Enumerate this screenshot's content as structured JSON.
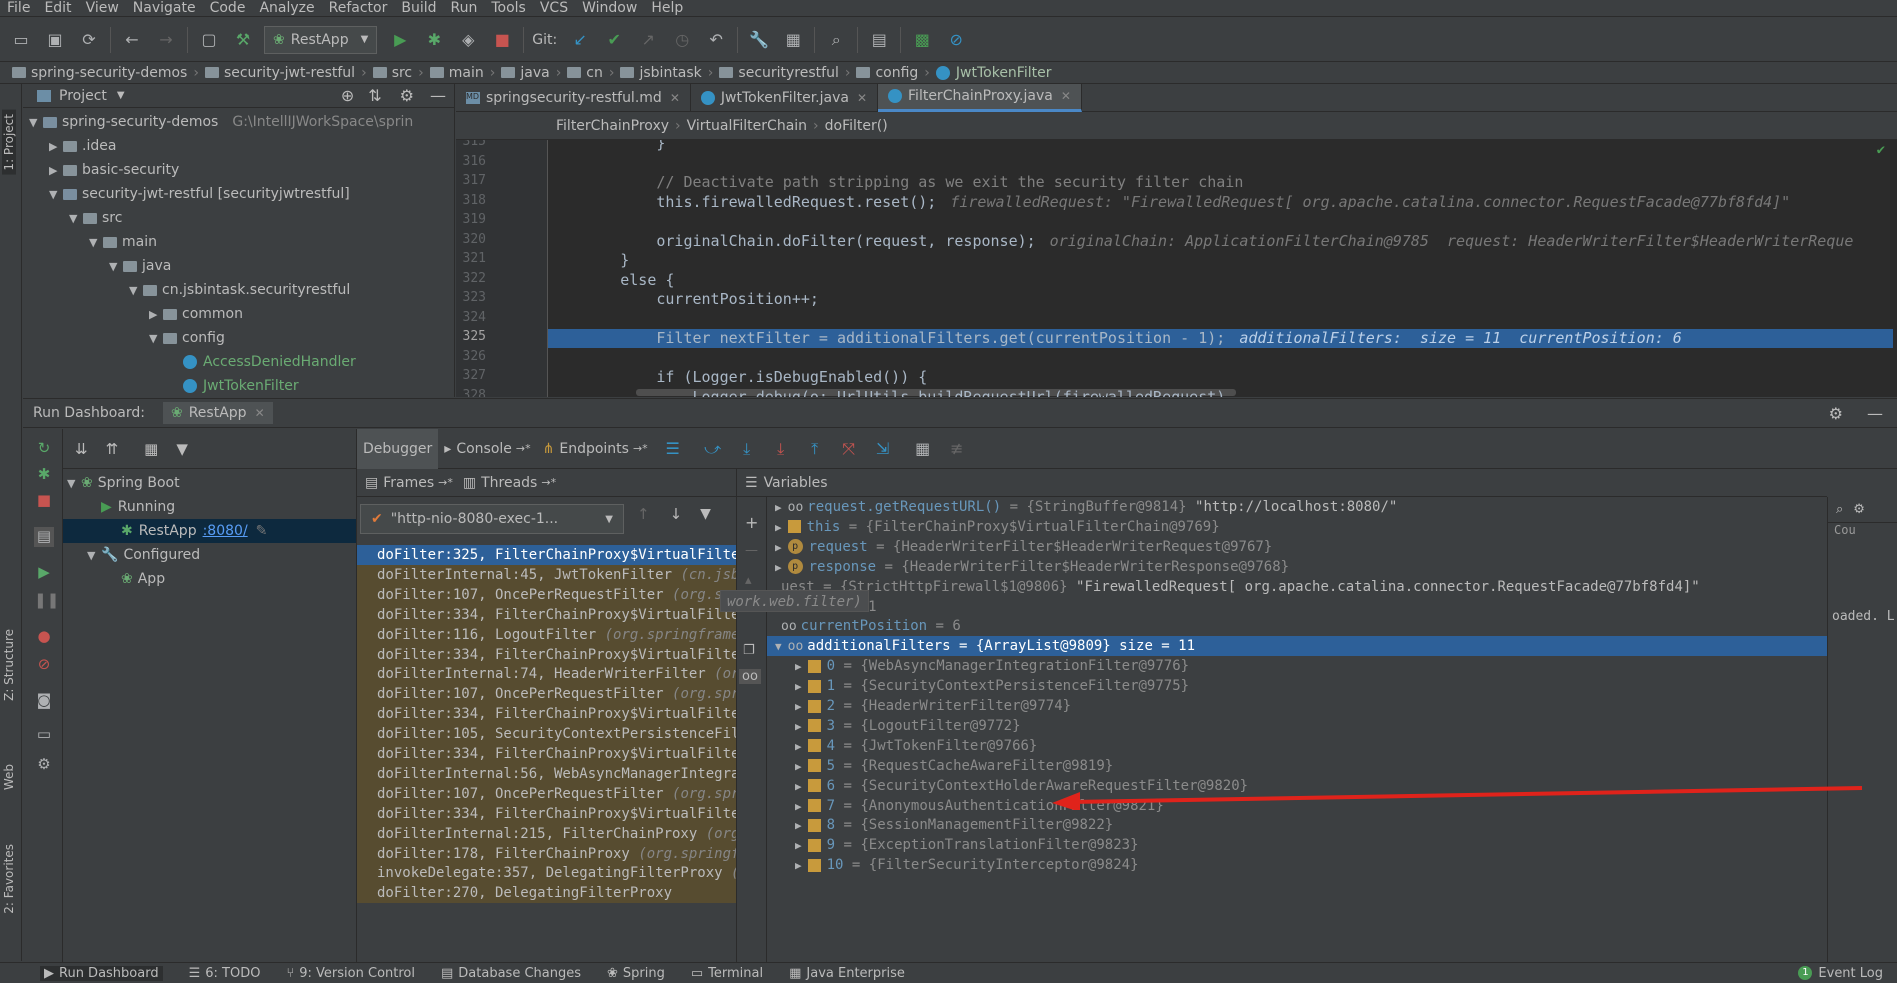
{
  "menu": [
    "File",
    "Edit",
    "View",
    "Navigate",
    "Code",
    "Analyze",
    "Refactor",
    "Build",
    "Run",
    "Tools",
    "VCS",
    "Window",
    "Help"
  ],
  "toolbar": {
    "run_config": "RestApp",
    "git_label": "Git:"
  },
  "breadcrumb": [
    "spring-security-demos",
    "security-jwt-restful",
    "src",
    "main",
    "java",
    "cn",
    "jsbintask",
    "securityrestful",
    "config",
    "JwtTokenFilter"
  ],
  "project": {
    "title": "Project",
    "tree": [
      {
        "label": "spring-security-demos",
        "extra": "G:\\IntellIJWorkSpace\\sprin",
        "depth": 0,
        "state": "open"
      },
      {
        "label": ".idea",
        "extra": "",
        "depth": 1,
        "state": "closed"
      },
      {
        "label": "basic-security",
        "extra": "",
        "depth": 1,
        "state": "closed"
      },
      {
        "label": "security-jwt-restful [securityjwtrestful]",
        "extra": "",
        "depth": 1,
        "state": "open"
      },
      {
        "label": "src",
        "extra": "",
        "depth": 2,
        "state": "open"
      },
      {
        "label": "main",
        "extra": "",
        "depth": 3,
        "state": "open"
      },
      {
        "label": "java",
        "extra": "",
        "depth": 4,
        "state": "open"
      },
      {
        "label": "cn.jsbintask.securityrestful",
        "extra": "",
        "depth": 5,
        "state": "open"
      },
      {
        "label": "common",
        "extra": "",
        "depth": 6,
        "state": "closed"
      },
      {
        "label": "config",
        "extra": "",
        "depth": 6,
        "state": "open"
      },
      {
        "label": "AccessDeniedHandler",
        "extra": "",
        "depth": 7,
        "state": "class"
      },
      {
        "label": "JwtTokenFilter",
        "extra": "",
        "depth": 7,
        "state": "class"
      }
    ]
  },
  "editor": {
    "tabs": [
      {
        "label": "springsecurity-restful.md",
        "active": false
      },
      {
        "label": "JwtTokenFilter.java",
        "active": false
      },
      {
        "label": "FilterChainProxy.java",
        "active": true
      }
    ],
    "crumbs": [
      "FilterChainProxy",
      "VirtualFilterChain",
      "doFilter()"
    ],
    "current_line": "325",
    "lines": [
      {
        "n": "315",
        "code": "            }",
        "hint": ""
      },
      {
        "n": "316",
        "code": "",
        "hint": ""
      },
      {
        "n": "317",
        "code": "            // Deactivate path stripping as we exit the security filter chain",
        "hint": "",
        "comment": true
      },
      {
        "n": "318",
        "code": "            this.firewalledRequest.reset();",
        "hint": "firewalledRequest: \"FirewalledRequest[ org.apache.catalina.connector.RequestFacade@77bf8fd4]\""
      },
      {
        "n": "319",
        "code": "",
        "hint": ""
      },
      {
        "n": "320",
        "code": "            originalChain.doFilter(request, response);",
        "hint": "originalChain: ApplicationFilterChain@9785  request: HeaderWriterFilter$HeaderWriterReque"
      },
      {
        "n": "321",
        "code": "        }",
        "hint": ""
      },
      {
        "n": "322",
        "code": "        else {",
        "hint": ""
      },
      {
        "n": "323",
        "code": "            currentPosition++;",
        "hint": ""
      },
      {
        "n": "324",
        "code": "",
        "hint": ""
      },
      {
        "n": "325",
        "code": "            Filter nextFilter = additionalFilters.get(currentPosition - 1);",
        "hint": "additionalFilters:  size = 11  currentPosition: 6"
      },
      {
        "n": "326",
        "code": "",
        "hint": ""
      },
      {
        "n": "327",
        "code": "            if (Logger.isDebugEnabled()) {",
        "hint": ""
      },
      {
        "n": "328",
        "code": "                Logger.debug(o: UrlUtils.buildRequestUrl(firewalledRequest)",
        "hint": ""
      }
    ]
  },
  "run_dashboard": {
    "title": "Run Dashboard:",
    "tab": "RestApp",
    "services": [
      {
        "label": "Spring Boot",
        "depth": 0
      },
      {
        "label": "Running",
        "depth": 1
      },
      {
        "label": "RestApp",
        "port": ":8080/",
        "depth": 2,
        "selected": true
      },
      {
        "label": "Configured",
        "depth": 1
      },
      {
        "label": "App",
        "depth": 2
      }
    ]
  },
  "debugger": {
    "tabs": [
      "Debugger",
      "Console",
      "Endpoints"
    ],
    "frames_tab": "Frames",
    "threads_tab": "Threads",
    "thread": "\"http-nio-8080-exec-1...",
    "frames": [
      {
        "m": "doFilter:325, FilterChainProxy$VirtualFilterC",
        "p": "",
        "sel": true
      },
      {
        "m": "doFilterInternal:45, JwtTokenFilter",
        "p": "(cn.jsb",
        "sel": false
      },
      {
        "m": "doFilter:107, OncePerRequestFilter",
        "p": "(org.springframework.web.filter)",
        "sel": false
      },
      {
        "m": "doFilter:334, FilterChainProxy$VirtualFilterC",
        "p": "",
        "sel": false
      },
      {
        "m": "doFilter:116, LogoutFilter",
        "p": "(org.springframew",
        "sel": false
      },
      {
        "m": "doFilter:334, FilterChainProxy$VirtualFilterC",
        "p": "",
        "sel": false
      },
      {
        "m": "doFilterInternal:74, HeaderWriterFilter",
        "p": "(org.",
        "sel": false
      },
      {
        "m": "doFilter:107, OncePerRequestFilter",
        "p": "(org.sprin",
        "sel": false
      },
      {
        "m": "doFilter:334, FilterChainProxy$VirtualFilterC",
        "p": "",
        "sel": false
      },
      {
        "m": "doFilter:105, SecurityContextPersistenceFilte",
        "p": "",
        "sel": false
      },
      {
        "m": "doFilter:334, FilterChainProxy$VirtualFilterC",
        "p": "",
        "sel": false
      },
      {
        "m": "doFilterInternal:56, WebAsyncManagerIntegrati",
        "p": "",
        "sel": false
      },
      {
        "m": "doFilter:107, OncePerRequestFilter",
        "p": "(org.sprin",
        "sel": false
      },
      {
        "m": "doFilter:334, FilterChainProxy$VirtualFilterC",
        "p": "",
        "sel": false
      },
      {
        "m": "doFilterInternal:215, FilterChainProxy",
        "p": "(org.s",
        "sel": false
      },
      {
        "m": "doFilter:178, FilterChainProxy",
        "p": "(org.springfra",
        "sel": false
      },
      {
        "m": "invokeDelegate:357, DelegatingFilterProxy",
        "p": "(or",
        "sel": false
      },
      {
        "m": "doFilter:270, DelegatingFilterProxy",
        "p": "",
        "sel": false
      }
    ],
    "variables_title": "Variables",
    "variables": [
      {
        "name": "request.getRequestURL()",
        "val": "= {StringBuffer@9814} ",
        "str": "\"http://localhost:8080/\"",
        "kind": "watch",
        "indent": 0
      },
      {
        "name": "this",
        "val": "= {FilterChainProxy$VirtualFilterChain@9769}",
        "str": "",
        "kind": "arr",
        "indent": 0
      },
      {
        "name": "request",
        "val": "= {HeaderWriterFilter$HeaderWriterRequest@9767}",
        "str": "",
        "kind": "p",
        "indent": 0
      },
      {
        "name": "response",
        "val": "= {HeaderWriterFilter$HeaderWriterResponse@9768}",
        "str": "",
        "kind": "p",
        "indent": 0
      },
      {
        "name": "",
        "val": "uest = {StrictHttpFirewall$1@9806} ",
        "str": "\"FirewalledRequest[ org.apache.catalina.connector.RequestFacade@77bf8fd4]\"",
        "kind": "none",
        "indent": 0
      },
      {
        "name": "size",
        "val": "= 11",
        "str": "",
        "kind": "watch",
        "indent": 0
      },
      {
        "name": "currentPosition",
        "val": "= 6",
        "str": "",
        "kind": "watch",
        "indent": 0
      },
      {
        "name": "additionalFilters",
        "val": "= {ArrayList@9809}  size = 11",
        "str": "",
        "kind": "watch",
        "indent": 0,
        "sel": true
      },
      {
        "name": "0",
        "val": "= {WebAsyncManagerIntegrationFilter@9776}",
        "str": "",
        "kind": "arr",
        "indent": 1
      },
      {
        "name": "1",
        "val": "= {SecurityContextPersistenceFilter@9775}",
        "str": "",
        "kind": "arr",
        "indent": 1
      },
      {
        "name": "2",
        "val": "= {HeaderWriterFilter@9774}",
        "str": "",
        "kind": "arr",
        "indent": 1
      },
      {
        "name": "3",
        "val": "= {LogoutFilter@9772}",
        "str": "",
        "kind": "arr",
        "indent": 1
      },
      {
        "name": "4",
        "val": "= {JwtTokenFilter@9766}",
        "str": "",
        "kind": "arr",
        "indent": 1
      },
      {
        "name": "5",
        "val": "= {RequestCacheAwareFilter@9819}",
        "str": "",
        "kind": "arr",
        "indent": 1
      },
      {
        "name": "6",
        "val": "= {SecurityContextHolderAwareRequestFilter@9820}",
        "str": "",
        "kind": "arr",
        "indent": 1
      },
      {
        "name": "7",
        "val": "= {AnonymousAuthenticationFilter@9821}",
        "str": "",
        "kind": "arr",
        "indent": 1
      },
      {
        "name": "8",
        "val": "= {SessionManagementFilter@9822}",
        "str": "",
        "kind": "arr",
        "indent": 1
      },
      {
        "name": "9",
        "val": "= {ExceptionTranslationFilter@9823}",
        "str": "",
        "kind": "arr",
        "indent": 1
      },
      {
        "name": "10",
        "val": "= {FilterSecurityInterceptor@9824}",
        "str": "",
        "kind": "arr",
        "indent": 1
      }
    ],
    "tooltip": "work.web.filter)",
    "right_panel": {
      "col": "Cou",
      "text": "oaded. L"
    }
  },
  "left_stripe": [
    "1: Project",
    "Z: Structure",
    "Web",
    "2: Favorites"
  ],
  "bottom_tabs": [
    "Run Dashboard",
    "6: TODO",
    "9: Version Control",
    "Database Changes",
    "Spring",
    "Terminal",
    "Java Enterprise"
  ],
  "event_log": {
    "badge": "1",
    "label": "Event Log"
  },
  "colors": {
    "accent": "#2d6099",
    "arrow": "#e0231b"
  }
}
